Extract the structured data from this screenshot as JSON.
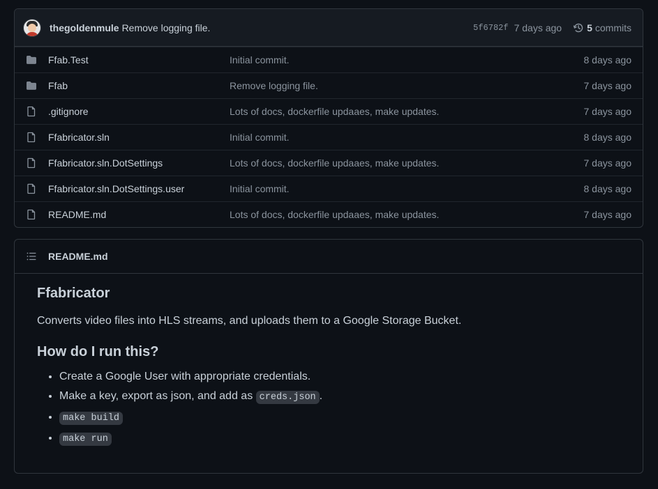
{
  "latest_commit": {
    "author": "thegoldenmule",
    "message": "Remove logging file.",
    "sha": "5f6782f",
    "age": "7 days ago",
    "commits_count": "5",
    "commits_label": "commits"
  },
  "files": [
    {
      "name": "Ffab.Test",
      "type": "folder",
      "message": "Initial commit.",
      "age": "8 days ago"
    },
    {
      "name": "Ffab",
      "type": "folder",
      "message": "Remove logging file.",
      "age": "7 days ago"
    },
    {
      "name": ".gitignore",
      "type": "file",
      "message": "Lots of docs, dockerfile updaaes, make updates.",
      "age": "7 days ago"
    },
    {
      "name": "Ffabricator.sln",
      "type": "file",
      "message": "Initial commit.",
      "age": "8 days ago"
    },
    {
      "name": "Ffabricator.sln.DotSettings",
      "type": "file",
      "message": "Lots of docs, dockerfile updaaes, make updates.",
      "age": "7 days ago"
    },
    {
      "name": "Ffabricator.sln.DotSettings.user",
      "type": "file",
      "message": "Initial commit.",
      "age": "8 days ago"
    },
    {
      "name": "README.md",
      "type": "file",
      "message": "Lots of docs, dockerfile updaaes, make updates.",
      "age": "7 days ago"
    }
  ],
  "readme": {
    "header_title": "README.md",
    "heading": "Ffabricator",
    "description": "Converts video files into HLS streams, and uploads them to a Google Storage Bucket.",
    "subheading": "How do I run this?",
    "steps": {
      "step1": "Create a Google User with appropriate credentials.",
      "step2_text": "Make a key, export as json, and add as ",
      "step2_code": "creds.json",
      "step2_end": ".",
      "step3_code": "make build",
      "step4_code": "make run"
    }
  },
  "colors": {
    "background": "#0d1117",
    "header_bg": "#161b22",
    "border": "#30363d",
    "text": "#c9d1d9",
    "muted": "#8b949e",
    "folder_icon": "#7d8590"
  },
  "icons": {
    "folder": "folder-icon",
    "file": "file-icon",
    "history": "history-icon",
    "list": "list-icon"
  }
}
